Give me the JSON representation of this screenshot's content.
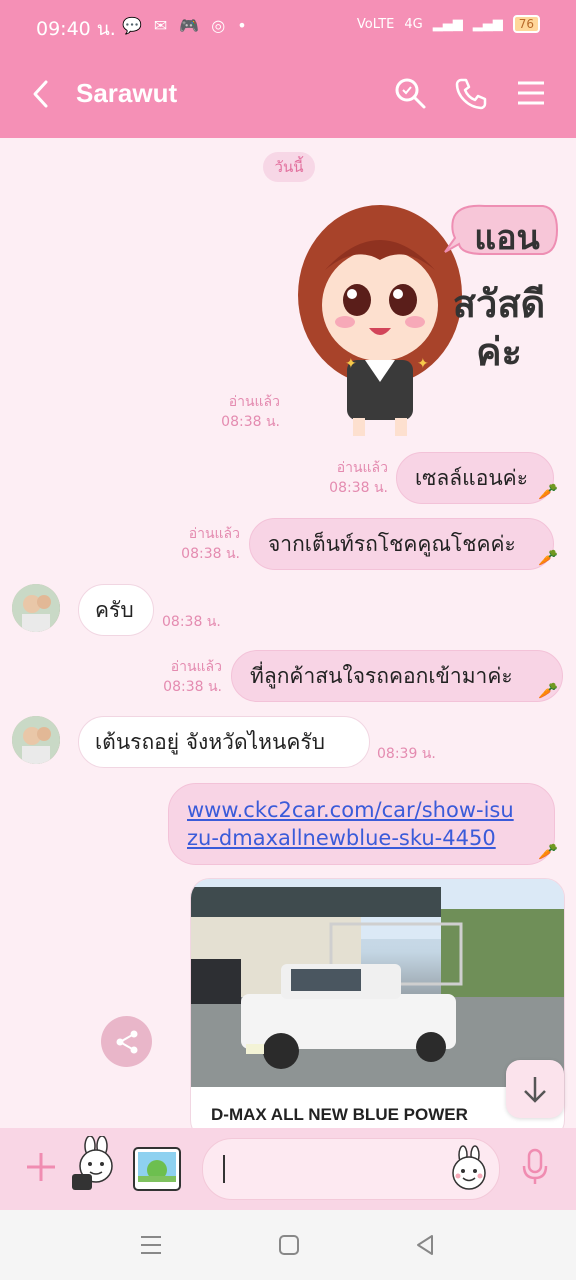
{
  "status": {
    "time": "09:40 น.",
    "network": "4G",
    "volte": "VoLTE",
    "battery": "76"
  },
  "header": {
    "title": "Sarawut"
  },
  "chat": {
    "date_chip": "วันนี้",
    "sticker": {
      "read": "อ่านแล้ว",
      "time": "08:38 น.",
      "text_top": "แอน",
      "text_bottom": "สวัสดีค่ะ"
    },
    "messages": [
      {
        "side": "out",
        "text": "เซลล์แอนค่ะ",
        "read": "อ่านแล้ว",
        "time": "08:38 น."
      },
      {
        "side": "out",
        "text": "จากเต็นท์รถโชคคูณโชคค่ะ",
        "read": "อ่านแล้ว",
        "time": "08:38 น."
      },
      {
        "side": "in",
        "text": "ครับ",
        "time": "08:38 น."
      },
      {
        "side": "out",
        "text": "ที่ลูกค้าสนใจรถคอกเข้ามาค่ะ",
        "read": "อ่านแล้ว",
        "time": "08:38 น."
      },
      {
        "side": "in",
        "text": "เต้นรถอยู่  จังหวัดไหนครับ",
        "time": "08:39 น."
      }
    ],
    "link_message": {
      "line1": "www.ckc2car.com/car/show-isu",
      "line2": "zu-dmaxallnewblue-sku-4450"
    },
    "card": {
      "title": "D-MAX ALL NEW BLUE POWER"
    }
  },
  "icons": {
    "back": "chevron-left-icon",
    "search": "search-icon",
    "call": "phone-icon",
    "menu": "menu-icon",
    "share": "share-icon",
    "scroll": "arrow-down-icon",
    "plus": "plus-icon",
    "mic": "mic-icon"
  },
  "colors": {
    "header": "#f590b6",
    "chat_bg": "#fdeef4",
    "bubble_out": "#f8d4e5",
    "accent_text": "#e48bb0"
  }
}
